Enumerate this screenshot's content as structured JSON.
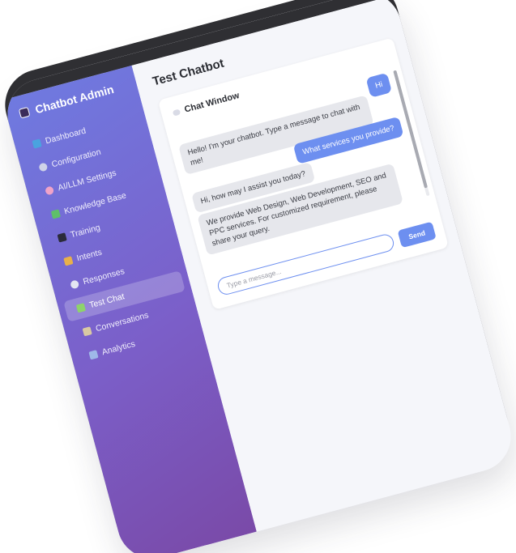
{
  "app": {
    "brand": "Chatbot Admin"
  },
  "sidebar": {
    "items": [
      {
        "label": "Dashboard",
        "icon": "bar-chart-icon",
        "color": "#4aa3df",
        "active": false
      },
      {
        "label": "Configuration",
        "icon": "gear-icon",
        "color": "#cfd3e8",
        "active": false
      },
      {
        "label": "AI/LLM Settings",
        "icon": "brain-icon",
        "color": "#f0a3c8",
        "active": false
      },
      {
        "label": "Knowledge Base",
        "icon": "books-icon",
        "color": "#5fbf6a",
        "active": false
      },
      {
        "label": "Training",
        "icon": "graduation-cap-icon",
        "color": "#2b2b3a",
        "active": false
      },
      {
        "label": "Intents",
        "icon": "tag-icon",
        "color": "#e8b04a",
        "active": false
      },
      {
        "label": "Responses",
        "icon": "speech-bubble-icon",
        "color": "#e4e6f2",
        "active": false
      },
      {
        "label": "Test Chat",
        "icon": "test-tube-icon",
        "color": "#8ed36b",
        "active": true
      },
      {
        "label": "Conversations",
        "icon": "clipboard-icon",
        "color": "#d9c9a3",
        "active": false
      },
      {
        "label": "Analytics",
        "icon": "line-chart-icon",
        "color": "#9fb8e8",
        "active": false
      }
    ]
  },
  "main": {
    "title": "Test Chatbot",
    "chat_window": {
      "title": "Chat Window",
      "messages": [
        {
          "sender": "user",
          "text": "Hi"
        },
        {
          "sender": "bot",
          "text": "Hello! I'm your chatbot. Type a message to chat with me!"
        },
        {
          "sender": "user",
          "text": "What services you provide?"
        },
        {
          "sender": "bot",
          "text": "Hi, how may I assist you today?"
        },
        {
          "sender": "bot",
          "text": "We provide Web Design, Web Development, SEO and PPC services. For customized requirement, please share your query."
        }
      ],
      "input_placeholder": "Type a message...",
      "send_label": "Send"
    }
  },
  "colors": {
    "accent": "#6d8ff0",
    "sidebar_start": "#6f7ae0",
    "sidebar_end": "#7a4aa8"
  }
}
